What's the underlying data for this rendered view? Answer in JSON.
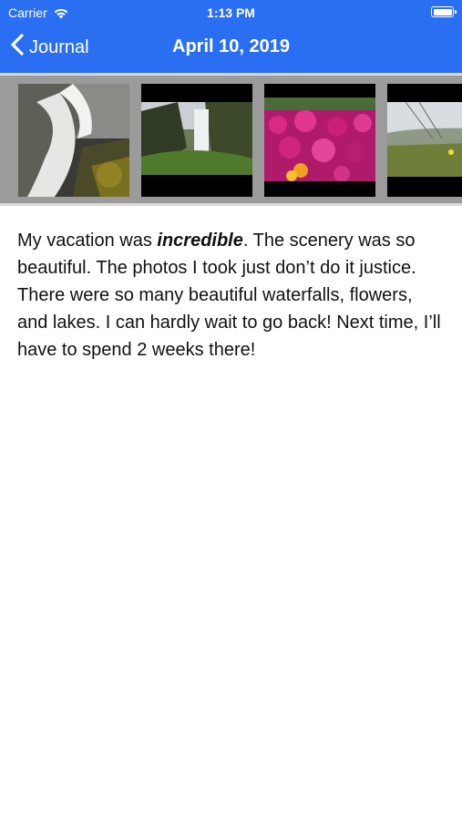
{
  "status_bar": {
    "carrier": "Carrier",
    "time": "1:13 PM",
    "wifi_icon": "wifi-icon",
    "battery_icon": "battery-icon"
  },
  "nav": {
    "back_label": "Journal",
    "back_icon": "chevron-left-icon",
    "title": "April 10, 2019"
  },
  "photos": [
    {
      "name": "waterfall-bw",
      "description_icon": "photo-thumbnail"
    },
    {
      "name": "waterfall-valley",
      "description_icon": "photo-thumbnail"
    },
    {
      "name": "flowers",
      "description_icon": "photo-thumbnail"
    },
    {
      "name": "coastal-meadow",
      "description_icon": "photo-thumbnail"
    }
  ],
  "entry": {
    "text_before": "My vacation was ",
    "emphasis": "incredible",
    "text_after": ".  The scenery was so beautiful.  The photos I took just don’t do it justice.  There were so many beautiful waterfalls, flowers, and lakes.  I can hardly wait to go back!  Next time, I’ll have to spend 2 weeks there!"
  },
  "colors": {
    "accent": "#2a6ff2",
    "strip_background": "#9b9b9b",
    "text": "#111111"
  }
}
